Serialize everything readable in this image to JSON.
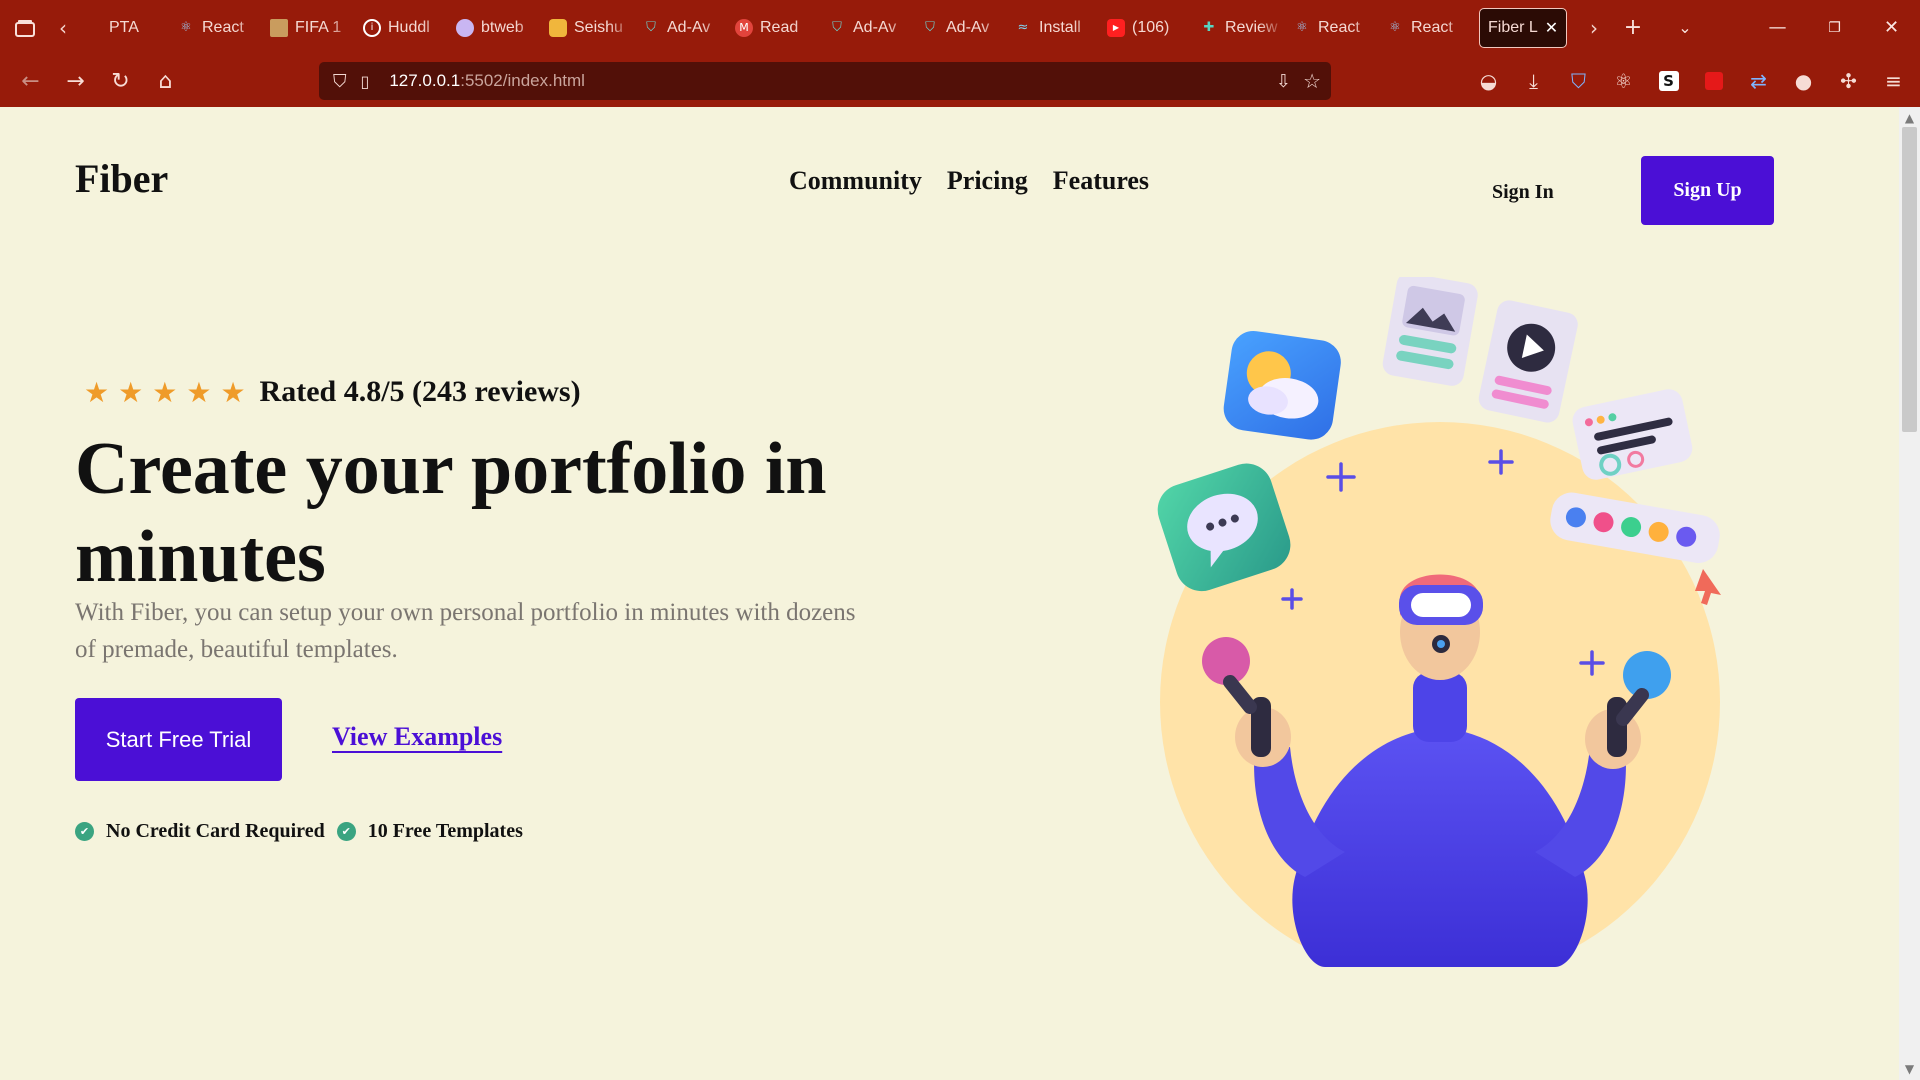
{
  "browser": {
    "tabs": [
      {
        "label": "PTA",
        "icon": "generic-icon"
      },
      {
        "label": "React",
        "icon": "react-icon"
      },
      {
        "label": "FIFA 1",
        "icon": "fifa-icon"
      },
      {
        "label": "Huddl",
        "icon": "info-icon"
      },
      {
        "label": "btweb",
        "icon": "btweb-icon"
      },
      {
        "label": "Seishu",
        "icon": "cat-icon"
      },
      {
        "label": "Ad-Av",
        "icon": "shield-icon"
      },
      {
        "label": "Read",
        "icon": "medium-icon"
      },
      {
        "label": "Ad-Av",
        "icon": "shield-icon"
      },
      {
        "label": "Ad-Av",
        "icon": "shield-icon"
      },
      {
        "label": "Install",
        "icon": "tailwind-icon"
      },
      {
        "label": "(106)",
        "icon": "youtube-icon"
      },
      {
        "label": "Review",
        "icon": "puzzle-icon"
      },
      {
        "label": "React",
        "icon": "react-icon"
      },
      {
        "label": "React",
        "icon": "react-icon"
      }
    ],
    "active_tab": {
      "label": "Fiber L"
    },
    "url": {
      "host": "127.0.0.1",
      "rest": ":5502/index.html"
    }
  },
  "site": {
    "logo": "Fiber",
    "nav": [
      "Community",
      "Pricing",
      "Features"
    ],
    "signin": "Sign In",
    "signup": "Sign Up",
    "rating": {
      "stars": 5,
      "text": "Rated 4.8/5 (243 reviews)"
    },
    "headline": "Create your portfolio in minutes",
    "subtext": "With Fiber, you can setup your own personal portfolio in minutes with dozens of premade, beautiful templates.",
    "cta_primary": "Start Free Trial",
    "cta_secondary": "View Examples",
    "features": [
      "No Credit Card Required",
      "10 Free Templates"
    ]
  },
  "colors": {
    "browser_chrome": "#971b0a",
    "page_background": "#f5f3dc",
    "accent": "#4b0fd6",
    "star": "#ef9b29",
    "check": "#3aa481"
  }
}
